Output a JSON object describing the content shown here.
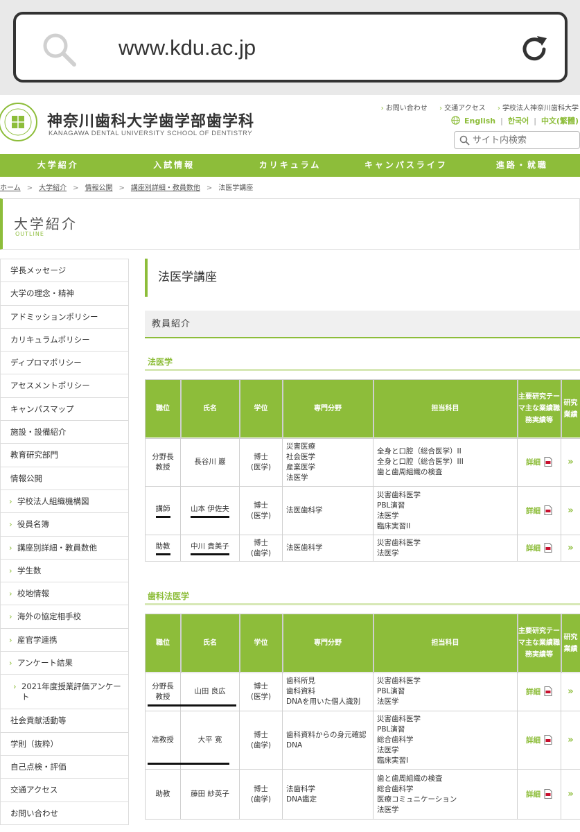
{
  "browser": {
    "url": "www.kdu.ac.jp"
  },
  "header": {
    "title": "神奈川歯科大学歯学部歯学科",
    "subtitle": "KANAGAWA DENTAL UNIVERSITY SCHOOL OF DENTISTRY",
    "util_links": [
      "お問い合わせ",
      "交通アクセス",
      "学校法人神奈川歯科大学"
    ],
    "languages": [
      "English",
      "한국어",
      "中文(繁體)"
    ],
    "search_placeholder": "サイト内検索"
  },
  "gnav": [
    "大学紹介",
    "入試情報",
    "カリキュラム",
    "キャンパスライフ",
    "進路・就職"
  ],
  "breadcrumb": {
    "links": [
      "ホーム",
      "大学紹介",
      "情報公開",
      "講座別詳細・教員数他"
    ],
    "current": "法医学講座"
  },
  "outline": {
    "title": "大学紹介",
    "sub": "OUTLINE"
  },
  "sidebar": [
    "学長メッセージ",
    "大学の理念・精神",
    "アドミッションポリシー",
    "カリキュラムポリシー",
    "ディプロマポリシー",
    "アセスメントポリシー",
    "キャンパスマップ",
    "施設・設備紹介",
    "教育研究部門",
    "情報公開",
    "学校法人組織機構図",
    "役員名簿",
    "講座別詳細・教員数他",
    "学生数",
    "校地情報",
    "海外の協定相手校",
    "産官学連携",
    "アンケート結果",
    "2021年度授業評価アンケート",
    "社会貢献活動等",
    "学則（抜粋）",
    "自己点検・評価",
    "交通アクセス",
    "お問い合わせ"
  ],
  "main": {
    "page_title": "法医学講座",
    "section_head": "教員紹介",
    "columns": [
      "職位",
      "氏名",
      "学位",
      "専門分野",
      "担当科目",
      "主要研究テーマ主な業績職務実績等",
      "研究業績"
    ],
    "detail_label": "詳細",
    "arrow": "»",
    "groups": [
      {
        "title": "法医学",
        "rows": [
          {
            "rank": "分野長\n教授",
            "name": "長谷川 巖",
            "degree": "博士\n(医学)",
            "field": "災害医療\n社会医学\n産業医学\n法医学",
            "subjects": "全身と口腔（総合医学）II\n全身と口腔（総合医学）III\n歯と歯周組織の検査"
          },
          {
            "rank": "講師",
            "name": "山本 伊佐夫",
            "degree": "博士\n(医学)",
            "field": "法医歯科学",
            "subjects": "災害歯科医学\nPBL演習\n法医学\n臨床実習II"
          },
          {
            "rank": "助教",
            "name": "中川 貴美子",
            "degree": "博士\n(歯学)",
            "field": "法医歯科学",
            "subjects": "災害歯科医学\n法医学"
          }
        ]
      },
      {
        "title": "歯科法医学",
        "rows": [
          {
            "rank": "分野長\n教授",
            "name": "山田 良広",
            "degree": "博士\n(医学)",
            "field": "歯科所見\n歯科資料\nDNAを用いた個人識別",
            "subjects": "災害歯科医学\nPBL演習\n法医学"
          },
          {
            "rank": "准教授",
            "name": "大平 寛",
            "degree": "博士\n(歯学)",
            "field": "歯科資料からの身元確認\nDNA",
            "subjects": "災害歯科医学\nPBL演習\n総合歯科学\n法医学\n臨床実習I"
          },
          {
            "rank": "助教",
            "name": "藤田 紗英子",
            "degree": "博士\n(歯学)",
            "field": "法歯科学\nDNA鑑定",
            "subjects": "歯と歯周組織の検査\n総合歯科学\n医療コミュニケーション\n法医学"
          }
        ]
      }
    ]
  }
}
